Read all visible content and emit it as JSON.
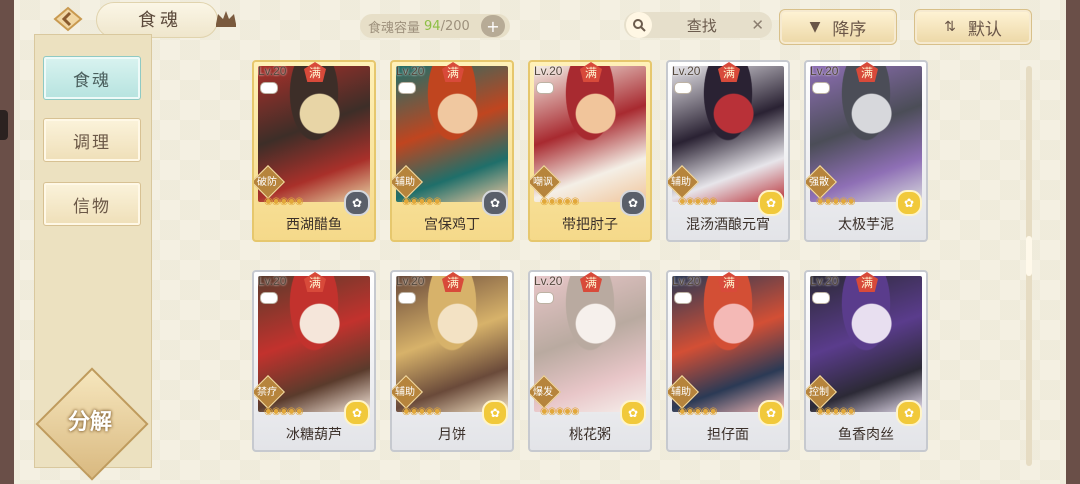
{
  "header": {
    "title": "食魂",
    "capacity_label": "食魂容量",
    "capacity_current": "94",
    "capacity_max": "/200",
    "add_symbol": "+",
    "search_placeholder": "查找",
    "clear_symbol": "✕",
    "sort_order_label": "降序",
    "sort_order_icon": "▼",
    "sort_mode_label": "默认",
    "sort_mode_icon": "⇅"
  },
  "sidebar": {
    "items": [
      {
        "label": "食魂",
        "active": true
      },
      {
        "label": "调理",
        "active": false
      },
      {
        "label": "信物",
        "active": false
      }
    ],
    "decompose_label": "分解"
  },
  "cards": [
    {
      "level": "Lv.20",
      "badge": "满",
      "role": "破防",
      "name": "西湖醋鱼",
      "frame": "gold",
      "stars": 5,
      "skill": "dark",
      "palette": [
        "#3d2e28",
        "#a9302a",
        "#e8d5a6"
      ]
    },
    {
      "level": "Lv.20",
      "badge": "满",
      "role": "辅助",
      "name": "宫保鸡丁",
      "frame": "gold",
      "stars": 5,
      "skill": "dark",
      "palette": [
        "#c0451f",
        "#1f6f6a",
        "#f0c8a0"
      ]
    },
    {
      "level": "Lv.20",
      "badge": "满",
      "role": "嘲讽",
      "name": "带把肘子",
      "frame": "gold",
      "stars": 5,
      "skill": "dark",
      "palette": [
        "#a82a30",
        "#f4efe6",
        "#f1c59b"
      ]
    },
    {
      "level": "Lv.20",
      "badge": "满",
      "role": "辅助",
      "name": "混汤酒酿元宵",
      "frame": "silver",
      "stars": 5,
      "skill": "gold",
      "palette": [
        "#2a2233",
        "#e7e5ea",
        "#b93138"
      ]
    },
    {
      "level": "Lv.20",
      "badge": "满",
      "role": "强散",
      "name": "太极芋泥",
      "frame": "silver",
      "stars": 5,
      "skill": "gold",
      "palette": [
        "#4b4d57",
        "#8e6fb5",
        "#d7d8dc"
      ]
    },
    {
      "level": "Lv.20",
      "badge": "满",
      "role": "禁疗",
      "name": "冰糖葫芦",
      "frame": "silver",
      "stars": 5,
      "skill": "gold",
      "palette": [
        "#c2322d",
        "#5a3b2c",
        "#f5e6da"
      ]
    },
    {
      "level": "Lv.20",
      "badge": "满",
      "role": "辅助",
      "name": "月饼",
      "frame": "silver",
      "stars": 5,
      "skill": "gold",
      "palette": [
        "#d7b26a",
        "#6a4a3a",
        "#f3e2c4"
      ]
    },
    {
      "level": "Lv.20",
      "badge": "满",
      "role": "爆发",
      "name": "桃花粥",
      "frame": "silver",
      "stars": 5,
      "skill": "gold",
      "palette": [
        "#b9aaa0",
        "#e8c6c8",
        "#f6f0ec"
      ]
    },
    {
      "level": "Lv.20",
      "badge": "满",
      "role": "辅助",
      "name": "担仔面",
      "frame": "silver",
      "stars": 5,
      "skill": "gold",
      "palette": [
        "#d34f35",
        "#2b3a55",
        "#f4b9b6"
      ]
    },
    {
      "level": "Lv.20",
      "badge": "满",
      "role": "控制",
      "name": "鱼香肉丝",
      "frame": "silver",
      "stars": 5,
      "skill": "gold",
      "palette": [
        "#5a3c8c",
        "#2c2a36",
        "#e8dff0"
      ]
    }
  ]
}
